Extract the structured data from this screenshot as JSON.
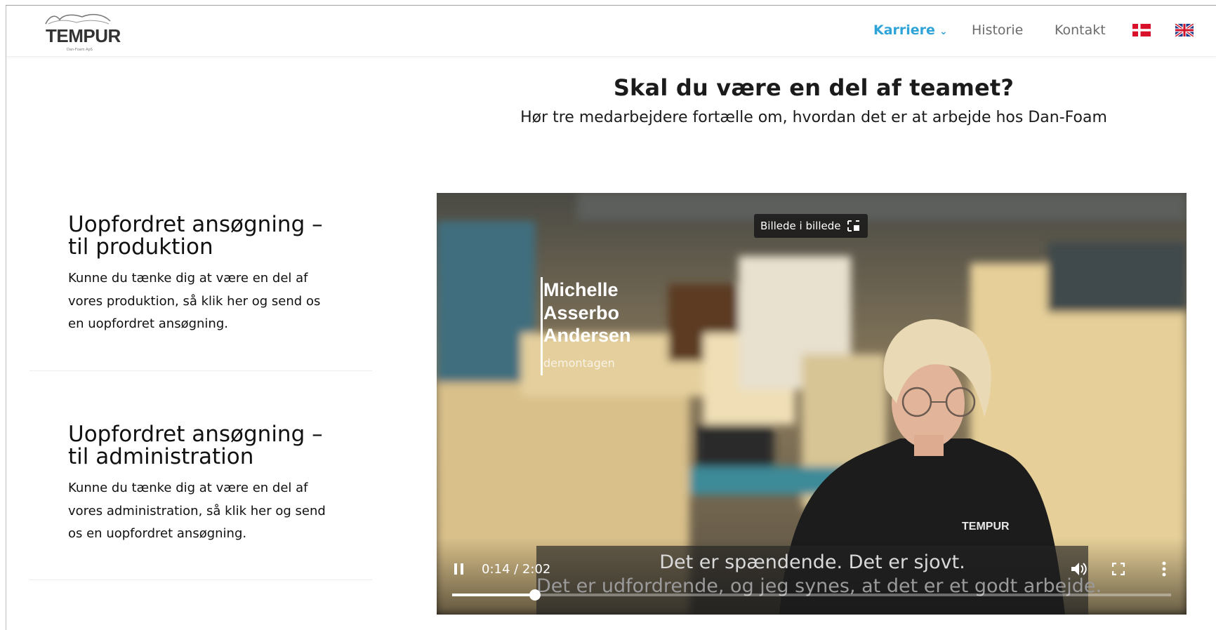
{
  "header": {
    "logo_text": "TEMPUR",
    "logo_subtext": "Dan-Foam ApS",
    "nav": {
      "karriere": "Karriere",
      "historie": "Historie",
      "kontakt": "Kontakt"
    },
    "language_flags": [
      "danish-flag-icon",
      "uk-flag-icon"
    ],
    "accent_color": "#2ea3d8"
  },
  "hero": {
    "title": "Skal du være en del af teamet?",
    "subtitle": "Hør tre medarbejdere fortælle om, hvordan det er at arbejde hos Dan-Foam"
  },
  "cards": [
    {
      "title_line1": "Uopfordret ansøgning –",
      "title_line2": "til produktion",
      "text_line1": "Kunne du tænke dig at være en del af",
      "text_line2": "vores produktion, så klik her og send os",
      "text_line3": "en uopfordret ansøgning."
    },
    {
      "title_line1": "Uopfordret ansøgning –",
      "title_line2": "til administration",
      "text_line1": "Kunne du tænke dig at være en del af",
      "text_line2": "vores administration, så klik her og send",
      "text_line3": "os en uopfordret ansøgning."
    }
  ],
  "video": {
    "pip_label": "Billede i billede",
    "name_line1": "Michelle",
    "name_line2": "Asserbo",
    "name_line3": "Andersen",
    "role": "demontagen",
    "subtitle_line1": "Det er spændende. Det er sjovt.",
    "subtitle_line2": "Det er udfordrende, og jeg synes, at det er et godt arbejde.",
    "time": "0:14 / 2:02",
    "progress_fraction": 0.1157,
    "shirt_logo": "TEMPUR"
  }
}
